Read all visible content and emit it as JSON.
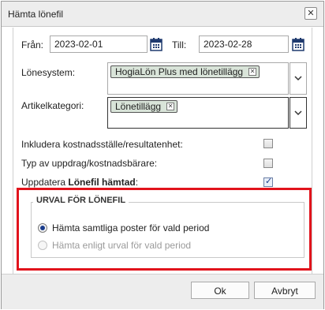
{
  "dialog": {
    "title": "Hämta lönefil",
    "close_symbol": "✕"
  },
  "form": {
    "from_label": "Från:",
    "from_date": "2023-02-01",
    "to_label": "Till:",
    "to_date": "2023-02-28",
    "lonesystem_label": "Lönesystem:",
    "lonesystem_chip": "HogiaLön Plus med lönetillägg",
    "artikel_label": "Artikelkategori:",
    "artikel_chip": "Lönetillägg",
    "chip_remove_symbol": "✕",
    "include_cost_label": "Inkludera kostnadsställe/resultatenhet:",
    "include_cost_checked": false,
    "type_label": "Typ av uppdrag/kostnadsbärare:",
    "type_checked": false,
    "update_prefix": "Uppdatera ",
    "update_bold": "Lönefil hämtad",
    "update_suffix": ":",
    "update_checked": true
  },
  "selection": {
    "title": "URVAL FÖR LÖNEFIL",
    "option_all": "Hämta samtliga poster för vald period",
    "option_filtered": "Hämta enligt urval för vald period",
    "selected": "option_all"
  },
  "footer": {
    "ok_label": "Ok",
    "cancel_label": "Avbryt"
  },
  "colors": {
    "highlight_border": "#e1131c",
    "chip_bg": "#d9e4d9",
    "icon_blue": "#1f3a6e"
  }
}
